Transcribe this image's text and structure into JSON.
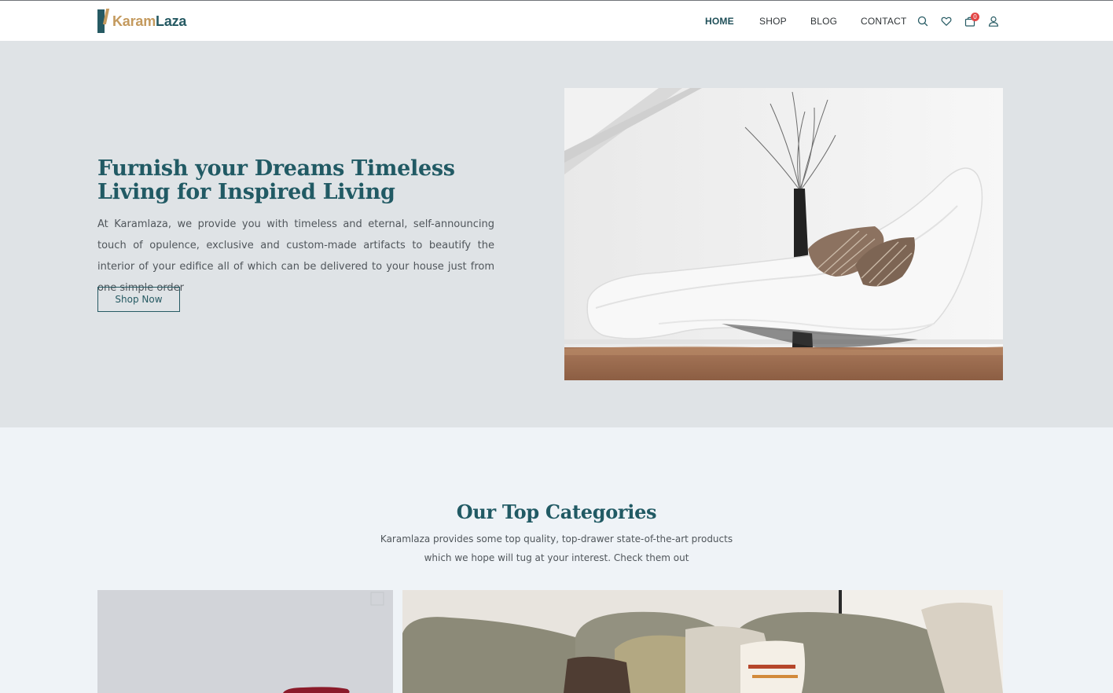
{
  "brand": {
    "name_part1": "Karam",
    "name_part2": "Laza"
  },
  "nav": {
    "items": [
      {
        "label": "HOME",
        "active": true
      },
      {
        "label": "SHOP",
        "active": false
      },
      {
        "label": "BLOG",
        "active": false
      },
      {
        "label": "CONTACT",
        "active": false
      }
    ],
    "cart_count": "0",
    "icons": [
      "search-icon",
      "heart-icon",
      "cart-icon",
      "user-icon"
    ]
  },
  "hero": {
    "title": "Furnish your Dreams Timeless Living for Inspired Living",
    "description": "At Karamlaza, we provide you with timeless and eternal, self-announcing touch of opulence, exclusive and custom-made artifacts to beautify the interior of your edifice all of which can be delivered to your house just from one simple order",
    "cta_label": "Shop Now",
    "image": "white chaise lounge with striped cushions and black vase on brown rug"
  },
  "categories": {
    "title": "Our Top Categories",
    "subtitle": "Karamlaza provides some top quality, top-drawer state-of-the-art products which we hope will tug at your interest. Check them out",
    "cards": [
      {
        "image": "grey wall with red cushion"
      },
      {
        "image": "grey sofa with cushions"
      }
    ]
  },
  "colors": {
    "brand_teal": "#265a63",
    "brand_gold": "#c49a5e",
    "hero_bg": "#dfe3e6",
    "page_bg": "#eff3f7",
    "badge_red": "#e34545"
  }
}
